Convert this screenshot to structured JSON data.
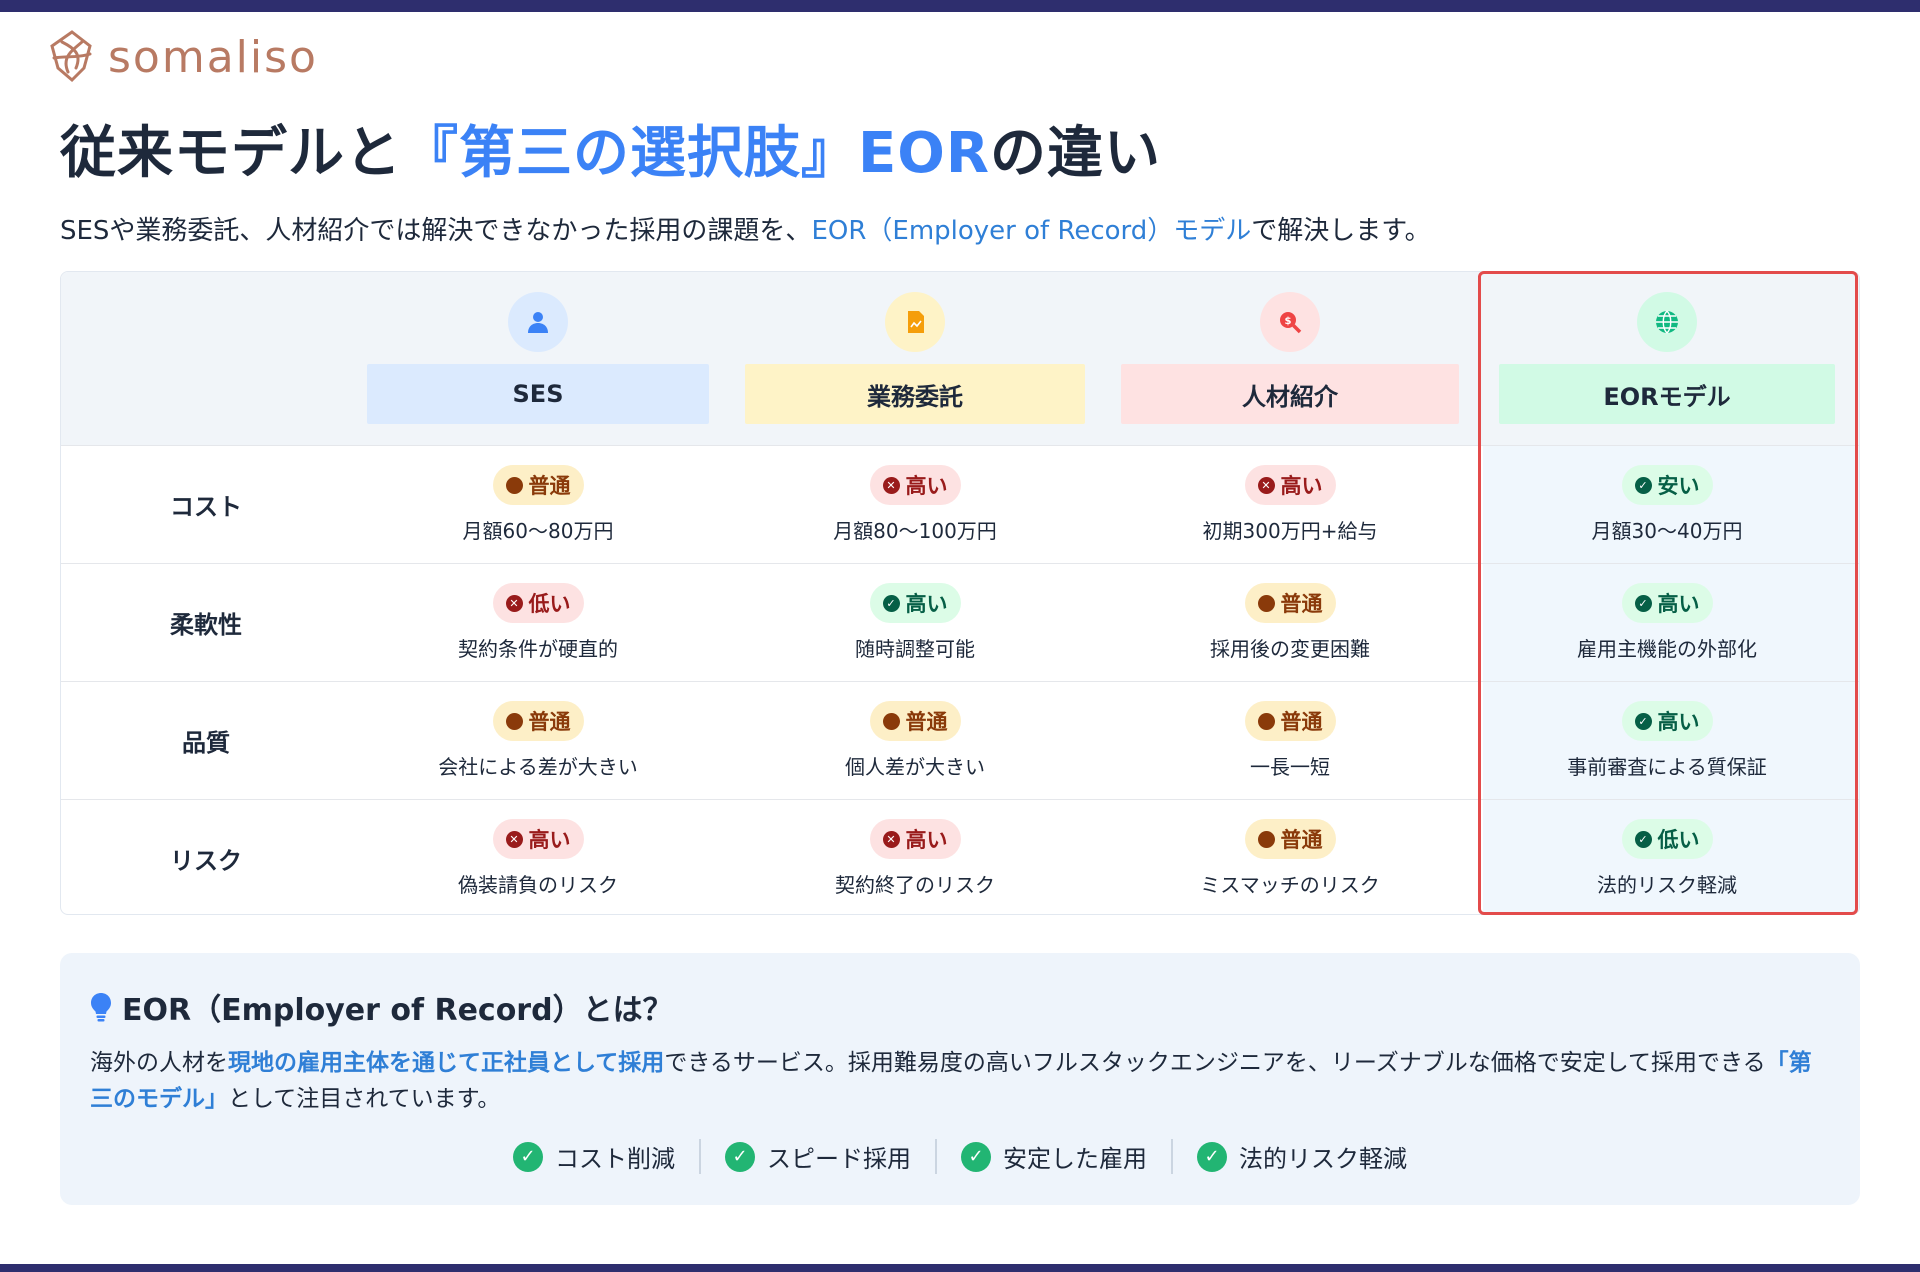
{
  "brand": {
    "name": "somaliso",
    "logo_icon": "somaliso-logo-icon"
  },
  "title": {
    "part1": "従来モデルと",
    "accent": "『第三の選択肢』EOR",
    "part2": "の違い"
  },
  "subtitle": {
    "before": "SESや業務委託、人材紹介では解決できなかった採用の課題を、",
    "link": "EOR（Employer of Record）モデル",
    "after": "で解決します。"
  },
  "columns": [
    {
      "label": "SES",
      "icon": "user-icon",
      "header_bg": "#dbeafe",
      "icon_bg": "#dbeafe",
      "icon_color": "#3b82f6"
    },
    {
      "label": "業務委託",
      "icon": "document-icon",
      "header_bg": "#fef3c7",
      "icon_bg": "#fef3c7",
      "icon_color": "#f59e0b"
    },
    {
      "label": "人材紹介",
      "icon": "search-dollar-icon",
      "header_bg": "#fee2e2",
      "icon_bg": "#fee2e2",
      "icon_color": "#ef4444"
    },
    {
      "label": "EORモデル",
      "icon": "globe-icon",
      "header_bg": "#d1fae5",
      "icon_bg": "#d1fae5",
      "icon_color": "#10b981"
    }
  ],
  "rows": [
    {
      "label": "コスト",
      "cells": [
        {
          "badge": "普通",
          "level": "normal",
          "text": "月額60〜80万円"
        },
        {
          "badge": "高い",
          "level": "bad",
          "text": "月額80〜100万円"
        },
        {
          "badge": "高い",
          "level": "bad",
          "text": "初期300万円+給与"
        },
        {
          "badge": "安い",
          "level": "good",
          "text": "月額30〜40万円"
        }
      ]
    },
    {
      "label": "柔軟性",
      "cells": [
        {
          "badge": "低い",
          "level": "bad",
          "text": "契約条件が硬直的"
        },
        {
          "badge": "高い",
          "level": "good",
          "text": "随時調整可能"
        },
        {
          "badge": "普通",
          "level": "normal",
          "text": "採用後の変更困難"
        },
        {
          "badge": "高い",
          "level": "good",
          "text": "雇用主機能の外部化"
        }
      ]
    },
    {
      "label": "品質",
      "cells": [
        {
          "badge": "普通",
          "level": "normal",
          "text": "会社による差が大きい"
        },
        {
          "badge": "普通",
          "level": "normal",
          "text": "個人差が大きい"
        },
        {
          "badge": "普通",
          "level": "normal",
          "text": "一長一短"
        },
        {
          "badge": "高い",
          "level": "good",
          "text": "事前審査による質保証"
        }
      ]
    },
    {
      "label": "リスク",
      "cells": [
        {
          "badge": "高い",
          "level": "bad",
          "text": "偽装請負のリスク"
        },
        {
          "badge": "高い",
          "level": "bad",
          "text": "契約終了のリスク"
        },
        {
          "badge": "普通",
          "level": "normal",
          "text": "ミスマッチのリスク"
        },
        {
          "badge": "低い",
          "level": "good",
          "text": "法的リスク軽減"
        }
      ]
    }
  ],
  "info": {
    "icon": "lightbulb-icon",
    "title": "EOR（Employer of Record）とは？",
    "desc_1": "海外の人材を",
    "desc_hl_1": "現地の雇用主体を通じて正社員として採用",
    "desc_2": "できるサービス。採用難易度の高いフルスタックエンジニアを、リーズナブルな価格で安定して採用でき",
    "desc_3": "る",
    "desc_hl_2": "「第三のモデル」",
    "desc_4": "として注目されています。",
    "benefits": [
      "コスト削減",
      "スピード採用",
      "安定した雇用",
      "法的リスク軽減"
    ]
  },
  "colors": {
    "accent": "#3b82f6",
    "highlight_border": "#e34b4b",
    "check_green": "#22b573",
    "frame_bar": "#2e2e6e"
  }
}
